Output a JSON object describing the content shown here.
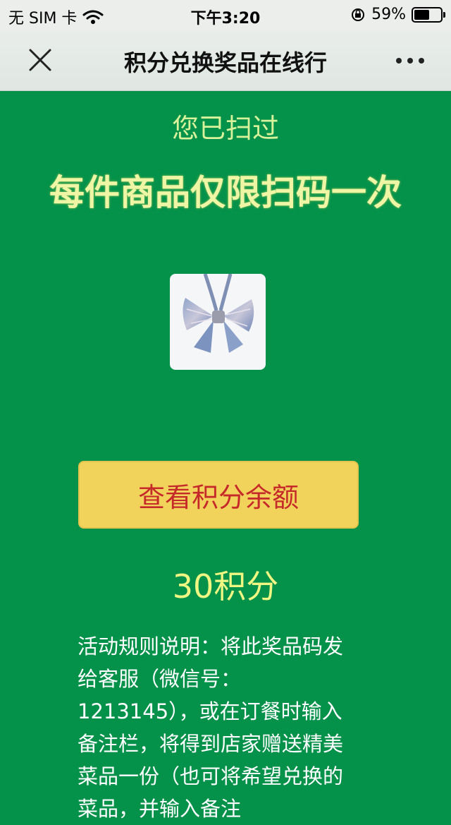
{
  "status_bar": {
    "carrier": "无 SIM 卡",
    "time": "下午3:20",
    "battery": "59%",
    "battery_level": 0.59
  },
  "nav": {
    "title": "积分兑换奖品在线行"
  },
  "main": {
    "scanned": "您已扫过",
    "limit": "每件商品仅限扫码一次",
    "button_label": "查看积分余额",
    "points": "30积分",
    "rules": "活动规则说明：将此奖品码发给客服（微信号：1213145），或在订餐时输入备注栏，将得到店家赠送精美菜品一份（也可将希望兑换的菜品，并输入备注"
  },
  "colors": {
    "background": "#04914a",
    "button": "#f1d35c",
    "button_text": "#c6292a",
    "headline": "#eef5a4"
  }
}
